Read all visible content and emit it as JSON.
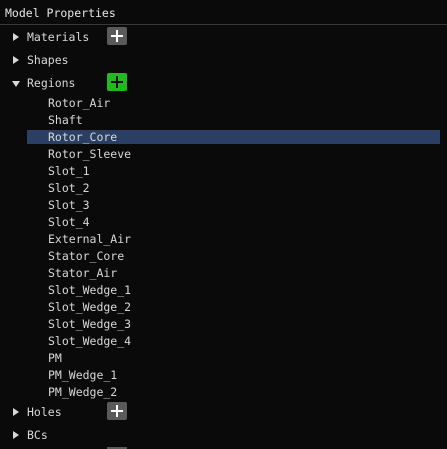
{
  "window": {
    "title": "Model Properties"
  },
  "tree": {
    "materials": {
      "label": "Materials",
      "expanded": false
    },
    "shapes": {
      "label": "Shapes",
      "expanded": false
    },
    "regions": {
      "label": "Regions",
      "expanded": true,
      "items": [
        {
          "label": "Rotor_Air",
          "selected": false
        },
        {
          "label": "Shaft",
          "selected": false
        },
        {
          "label": "Rotor_Core",
          "selected": true
        },
        {
          "label": "Rotor_Sleeve",
          "selected": false
        },
        {
          "label": "Slot_1",
          "selected": false
        },
        {
          "label": "Slot_2",
          "selected": false
        },
        {
          "label": "Slot_3",
          "selected": false
        },
        {
          "label": "Slot_4",
          "selected": false
        },
        {
          "label": "External_Air",
          "selected": false
        },
        {
          "label": "Stator_Core",
          "selected": false
        },
        {
          "label": "Stator_Air",
          "selected": false
        },
        {
          "label": "Slot_Wedge_1",
          "selected": false
        },
        {
          "label": "Slot_Wedge_2",
          "selected": false
        },
        {
          "label": "Slot_Wedge_3",
          "selected": false
        },
        {
          "label": "Slot_Wedge_4",
          "selected": false
        },
        {
          "label": "PM",
          "selected": false
        },
        {
          "label": "PM_Wedge_1",
          "selected": false
        },
        {
          "label": "PM_Wedge_2",
          "selected": false
        }
      ]
    },
    "holes": {
      "label": "Holes",
      "expanded": false
    },
    "bcs": {
      "label": "BCs",
      "expanded": false
    }
  },
  "icons": {
    "expand": "triangle-right-icon",
    "collapse": "triangle-down-icon",
    "add": "plus-icon"
  },
  "colors": {
    "background": "#0a0a0a",
    "text": "#d8d8d8",
    "selection": "#2a3f63",
    "add_button": "#5a5a5a",
    "add_button_active": "#22b81f"
  }
}
